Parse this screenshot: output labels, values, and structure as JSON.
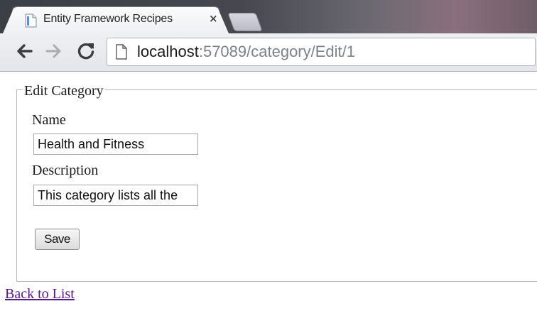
{
  "browser": {
    "tab_title": "Entity Framework Recipes",
    "tab_close": "×",
    "url_host": "localhost",
    "url_path": ":57089/category/Edit/1"
  },
  "form": {
    "legend": "Edit Category",
    "name_label": "Name",
    "name_value": "Health and Fitness",
    "description_label": "Description",
    "description_value": "This category lists all the",
    "save_label": "Save"
  },
  "links": {
    "back_to_list": "Back to List"
  },
  "colors": {
    "visited_link": "#551a8b",
    "url_path": "#7d8189"
  }
}
